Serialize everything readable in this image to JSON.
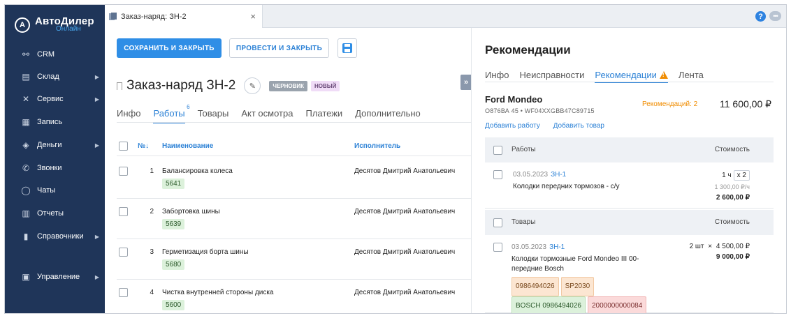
{
  "app": {
    "logo_title": "АвтоДилер",
    "logo_sub": "Онлайн"
  },
  "sidebar": {
    "items": [
      {
        "label": "CRM",
        "icon": "handshake-icon",
        "chevron": false
      },
      {
        "label": "Склад",
        "icon": "warehouse-icon",
        "chevron": true
      },
      {
        "label": "Сервис",
        "icon": "wrench-icon",
        "chevron": true
      },
      {
        "label": "Запись",
        "icon": "calendar-icon",
        "chevron": false
      },
      {
        "label": "Деньги",
        "icon": "wallet-icon",
        "chevron": true
      },
      {
        "label": "Звонки",
        "icon": "phone-icon",
        "chevron": false
      },
      {
        "label": "Чаты",
        "icon": "whatsapp-icon",
        "chevron": false
      },
      {
        "label": "Отчеты",
        "icon": "chart-icon",
        "chevron": false
      },
      {
        "label": "Справочники",
        "icon": "book-icon",
        "chevron": true
      },
      {
        "label": "Управление",
        "icon": "settings-panel-icon",
        "chevron": true
      }
    ]
  },
  "tabbar": {
    "tab_label": "Заказ-наряд: ЗН-2",
    "close_glyph": "×",
    "help_glyph": "?"
  },
  "toolbar": {
    "save_close_label": "СОХРАНИТЬ И ЗАКРЫТЬ",
    "post_close_label": "ПРОВЕСТИ И ЗАКРЫТЬ"
  },
  "document": {
    "title": "Заказ-наряд ЗН-2",
    "status_badge": "ЧЕРНОВИК",
    "new_badge": "НОВЫЙ"
  },
  "subtabs": [
    {
      "label": "Инфо",
      "active": false
    },
    {
      "label": "Работы",
      "active": true,
      "count": "6"
    },
    {
      "label": "Товары",
      "active": false
    },
    {
      "label": "Акт осмотра",
      "active": false
    },
    {
      "label": "Платежи",
      "active": false
    },
    {
      "label": "Дополнительно",
      "active": false
    }
  ],
  "works_table": {
    "headers": {
      "num": "№↓",
      "name": "Наименование",
      "executor": "Исполнитель"
    },
    "rows": [
      {
        "num": "1",
        "name": "Балансировка колеса",
        "code": "5641",
        "executor": "Десятов Дмитрий Анатольевич"
      },
      {
        "num": "2",
        "name": "Забортовка шины",
        "code": "5639",
        "executor": "Десятов Дмитрий Анатольевич"
      },
      {
        "num": "3",
        "name": "Герметизация борта шины",
        "code": "5680",
        "executor": "Десятов Дмитрий Анатольевич"
      },
      {
        "num": "4",
        "name": "Чистка внутренней стороны диска",
        "code": "5600",
        "executor": "Десятов Дмитрий Анатольевич"
      }
    ]
  },
  "collapse_glyph": "»",
  "panel": {
    "title": "Рекомендации",
    "tabs": [
      {
        "label": "Инфо",
        "active": false
      },
      {
        "label": "Неисправности",
        "active": false
      },
      {
        "label": "Рекомендации",
        "active": true,
        "warning": true
      },
      {
        "label": "Лента",
        "active": false
      }
    ],
    "car_name": "Ford Mondeo",
    "car_plate": "О876ВА 45 • WF04XXGBB47C89715",
    "rec_count": "Рекомендаций: 2",
    "rec_total": "11 600,00 ₽",
    "add_work": "Добавить работу",
    "add_goods": "Добавить товар",
    "works_section": {
      "label": "Работы",
      "cost_label": "Стоимость",
      "item": {
        "date": "03.05.2023",
        "doc": "ЗН-1",
        "desc": "Колодки передних тормозов - с/у",
        "qty": "1 ч",
        "multiplier": "x 2",
        "rate": "1 300,00 ₽/ч",
        "total": "2 600,00 ₽"
      }
    },
    "goods_section": {
      "label": "Товары",
      "cost_label": "Стоимость",
      "item": {
        "date": "03.05.2023",
        "doc": "ЗН-1",
        "desc_line1": "Колодки тормозные Ford Mondeo III 00-",
        "desc_line2": "передние Bosch",
        "qty": "2 шт",
        "mult": "×",
        "price": "4 500,00 ₽",
        "total": "9 000,00 ₽",
        "tags": [
          {
            "label": "0986494026",
            "kind": "orange"
          },
          {
            "label": "SP2030",
            "kind": "orange"
          },
          {
            "label": "BOSCH 0986494026",
            "kind": "green"
          },
          {
            "label": "2000000000084",
            "kind": "red"
          }
        ]
      }
    }
  },
  "colors": {
    "sidebar_bg": "#1f3559",
    "accent": "#2f8ee6",
    "warning": "#f08c00"
  }
}
